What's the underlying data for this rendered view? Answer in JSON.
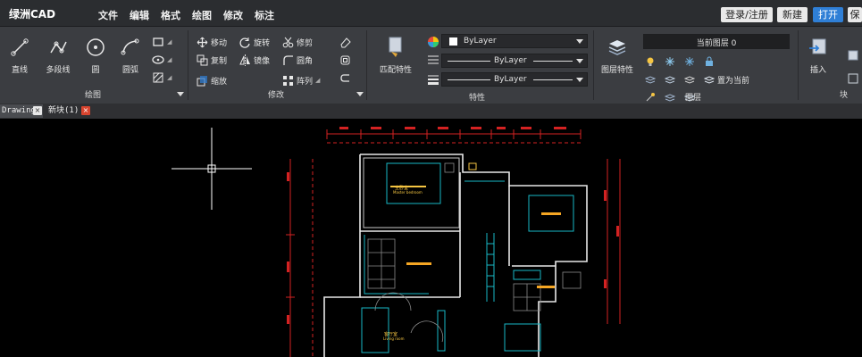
{
  "app": {
    "logo": "绿洲CAD"
  },
  "menu": [
    "文件",
    "编辑",
    "格式",
    "绘图",
    "修改",
    "标注"
  ],
  "top_buttons": {
    "login": "登录/注册",
    "new": "新建",
    "open": "打开",
    "save_partial": "保"
  },
  "draw_panel": {
    "title": "绘图",
    "tools": [
      "直线",
      "多段线",
      "圆",
      "圆弧"
    ]
  },
  "modify_panel": {
    "title": "修改",
    "tools": [
      "移动",
      "旋转",
      "修剪",
      "复制",
      "镜像",
      "圆角",
      "缩放",
      "阵列"
    ]
  },
  "props_panel": {
    "title": "特性",
    "match_label": "匹配特性",
    "color_value": "ByLayer",
    "linetype_value": "ByLayer",
    "lineweight_value": "ByLayer"
  },
  "layer_panel": {
    "title": "图层",
    "layer_props_label": "图层特性",
    "current_layer": "当前图层 0",
    "set_current_label": "置为当前"
  },
  "block_panel": {
    "title": "块",
    "insert_label": "插入"
  },
  "tabs": [
    {
      "label": "Drawing1"
    },
    {
      "label": "新块(1)"
    }
  ],
  "drawing": {
    "room_labels": {
      "master": "主卧室",
      "master_en": "Master bedroom",
      "living": "客厅室",
      "living_en": "Living room"
    }
  },
  "colors": {
    "accent_blue": "#2f7fd6",
    "tab_close": "#d9452f",
    "ribbon": "#3b3d41",
    "menubar": "#2b2d30"
  }
}
